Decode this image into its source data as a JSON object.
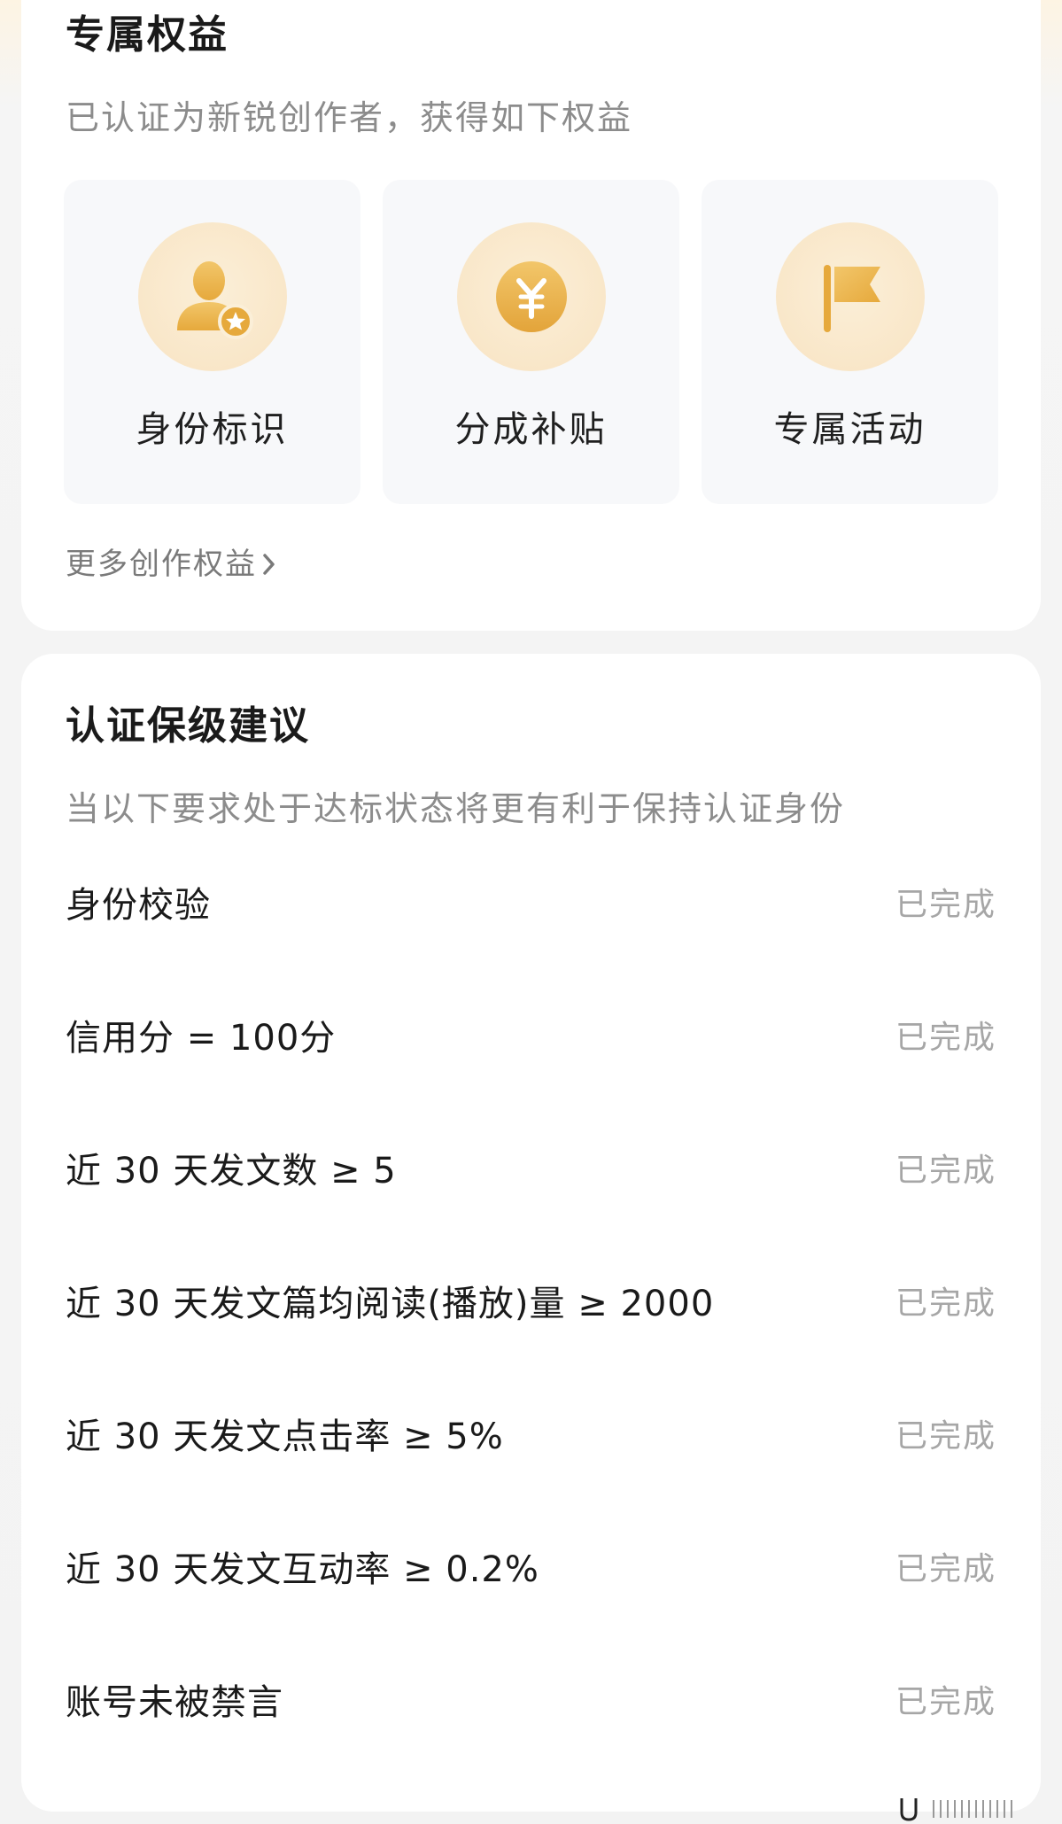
{
  "benefits": {
    "title": "专属权益",
    "subtitle": "已认证为新锐创作者，获得如下权益",
    "tiles": [
      {
        "label": "身份标识",
        "icon": "user-badge-icon"
      },
      {
        "label": "分成补贴",
        "icon": "yuan-coin-icon"
      },
      {
        "label": "专属活动",
        "icon": "flag-icon"
      }
    ],
    "more_label": "更多创作权益",
    "accent_color": "#e8b44a"
  },
  "advice": {
    "title": "认证保级建议",
    "subtitle": "当以下要求处于达标状态将更有利于保持认证身份",
    "items": [
      {
        "text": "身份校验",
        "status": "已完成"
      },
      {
        "text": "信用分 = 100分",
        "status": "已完成"
      },
      {
        "text": "近 30 天发文数 ≥ 5",
        "status": "已完成"
      },
      {
        "text": "近 30 天发文篇均阅读(播放)量 ≥ 2000",
        "status": "已完成"
      },
      {
        "text": "近 30 天发文点击率 ≥ 5%",
        "status": "已完成"
      },
      {
        "text": "近 30 天发文互动率 ≥ 0.2%",
        "status": "已完成"
      },
      {
        "text": "账号未被禁言",
        "status": "已完成"
      }
    ]
  }
}
